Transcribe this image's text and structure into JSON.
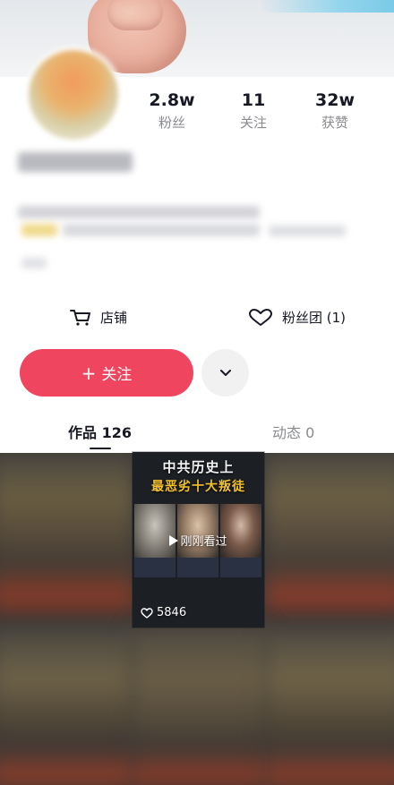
{
  "profile": {
    "stats": [
      {
        "value": "2.8w",
        "label": "粉丝"
      },
      {
        "value": "11",
        "label": "关注"
      },
      {
        "value": "32w",
        "label": "获赞"
      }
    ]
  },
  "actions": {
    "shop_label": "店铺",
    "fan_group_label": "粉丝团 (1)",
    "follow_label": "关注",
    "follow_plus": "+"
  },
  "tabs": [
    {
      "label": "作品 126",
      "selected": true
    },
    {
      "label": "动态 0",
      "selected": false
    }
  ],
  "video_card": {
    "title_line1": "中共历史上",
    "title_line2": "最恶劣十大叛徒",
    "seen_text": "刚刚看过",
    "likes": "5846"
  },
  "icons": {
    "shop": "cart-icon",
    "fan_group": "heart-icon",
    "more": "chevron-down-icon",
    "play": "play-icon",
    "likes": "heart-outline-icon"
  },
  "colors": {
    "follow_button": "#f0455f",
    "title_yellow": "#f2c12e"
  }
}
